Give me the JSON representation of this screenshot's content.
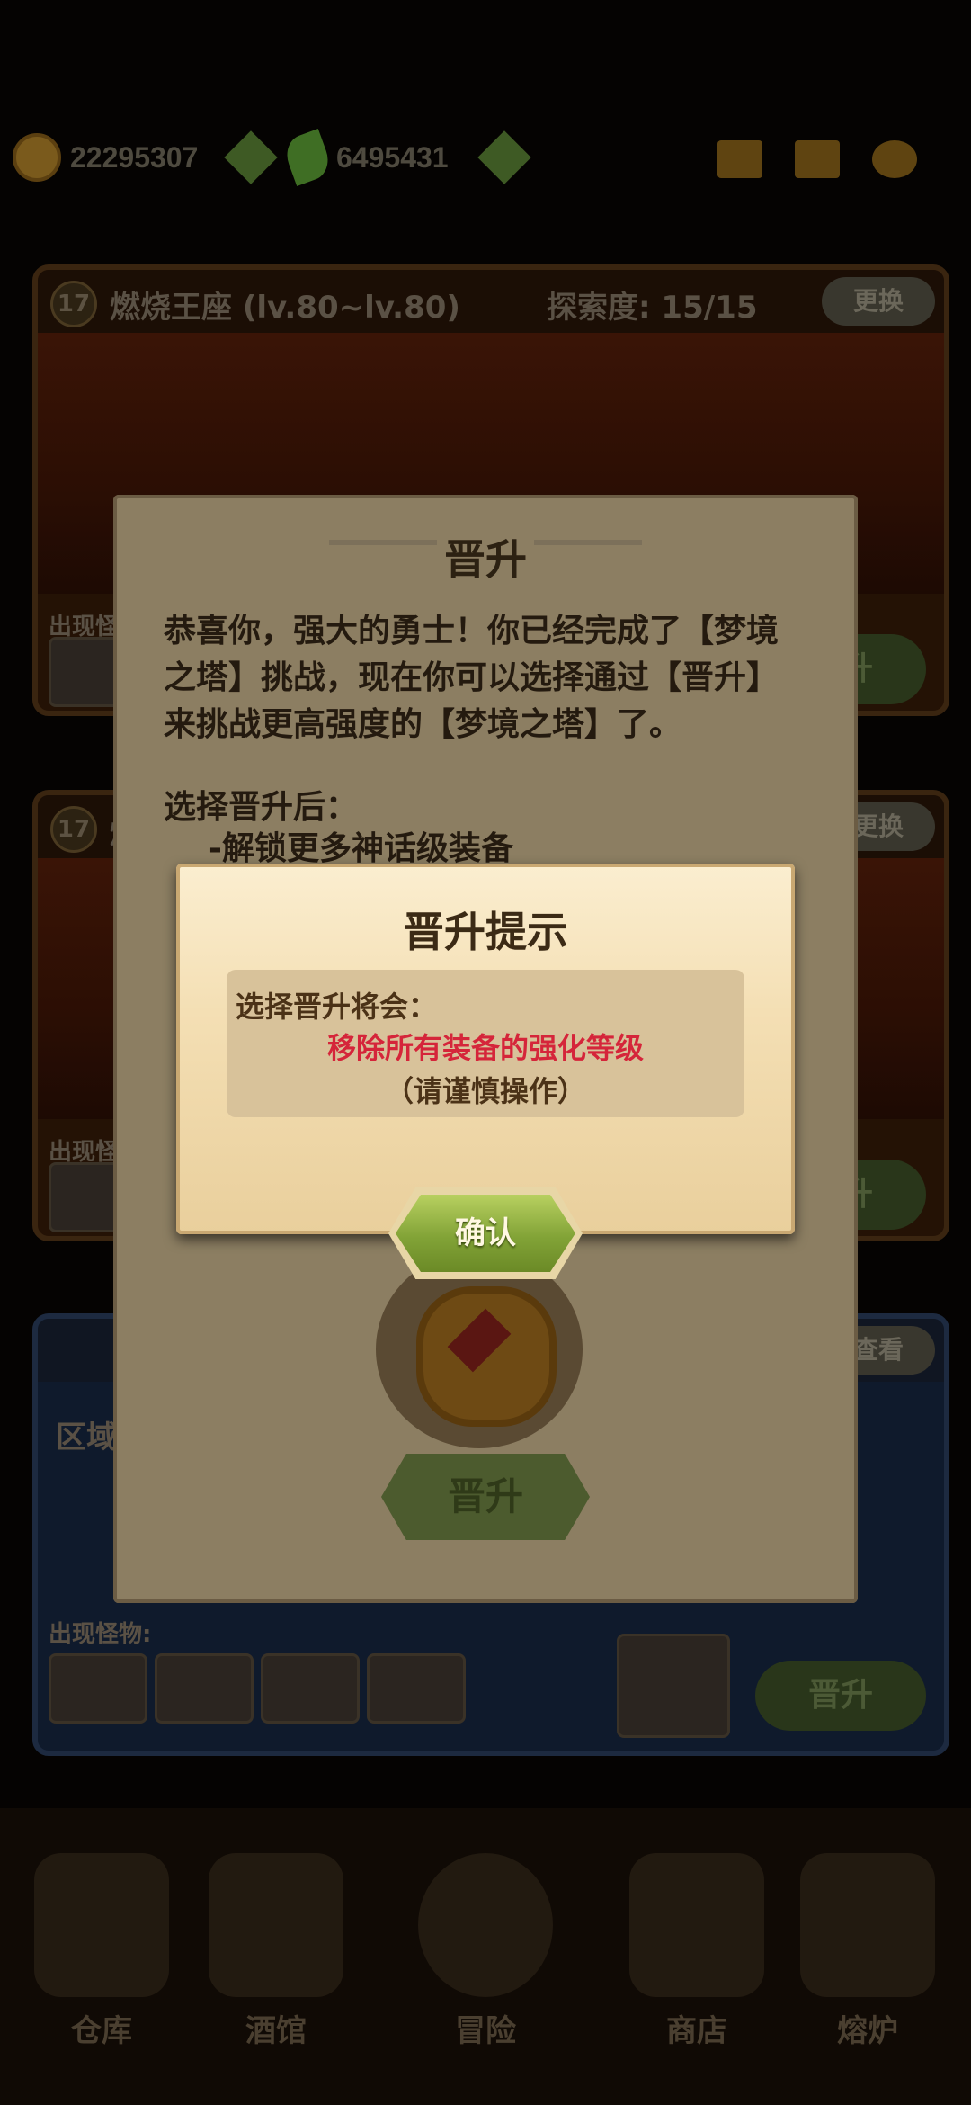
{
  "resources": {
    "gold": "22295307",
    "leaves": "6495431"
  },
  "stages": [
    {
      "level": "17",
      "name": "燃烧王座 (lv.80~lv.80)",
      "explore": "探索度: 15/15",
      "change": "更换",
      "monsters_label": "出现怪",
      "promote": "晋升"
    },
    {
      "level": "17",
      "name": "燃",
      "explore": "",
      "change": "更换",
      "monsters_label": "出现怪",
      "promote": "晋升"
    },
    {
      "level": "",
      "name": "区域",
      "explore": "",
      "change": "查看",
      "monsters_label": "出现怪物:",
      "promote": "晋升"
    }
  ],
  "nav": [
    {
      "label": "仓库",
      "icon": "warehouse-icon"
    },
    {
      "label": "酒馆",
      "icon": "tavern-icon"
    },
    {
      "label": "冒险",
      "icon": "adventure-icon"
    },
    {
      "label": "商店",
      "icon": "shop-icon"
    },
    {
      "label": "熔炉",
      "icon": "furnace-icon"
    }
  ],
  "promote_dialog": {
    "title": "晋升",
    "body": "恭喜你，强大的勇士！你已经完成了【梦境之塔】挑战，现在你可以选择通过【晋升】来挑战更高强度的【梦境之塔】了。",
    "after_label": "选择晋升后：",
    "unlock": "-解锁更多神话级装备",
    "button": "晋升"
  },
  "confirm_dialog": {
    "title": "晋升提示",
    "line1": "选择晋升将会：",
    "warning": "移除所有装备的强化等级",
    "caution": "（请谨慎操作）",
    "confirm": "确认"
  },
  "colors": {
    "warning": "#d5253a",
    "button_green": "#82a337",
    "parchment": "#f4dfb4"
  }
}
